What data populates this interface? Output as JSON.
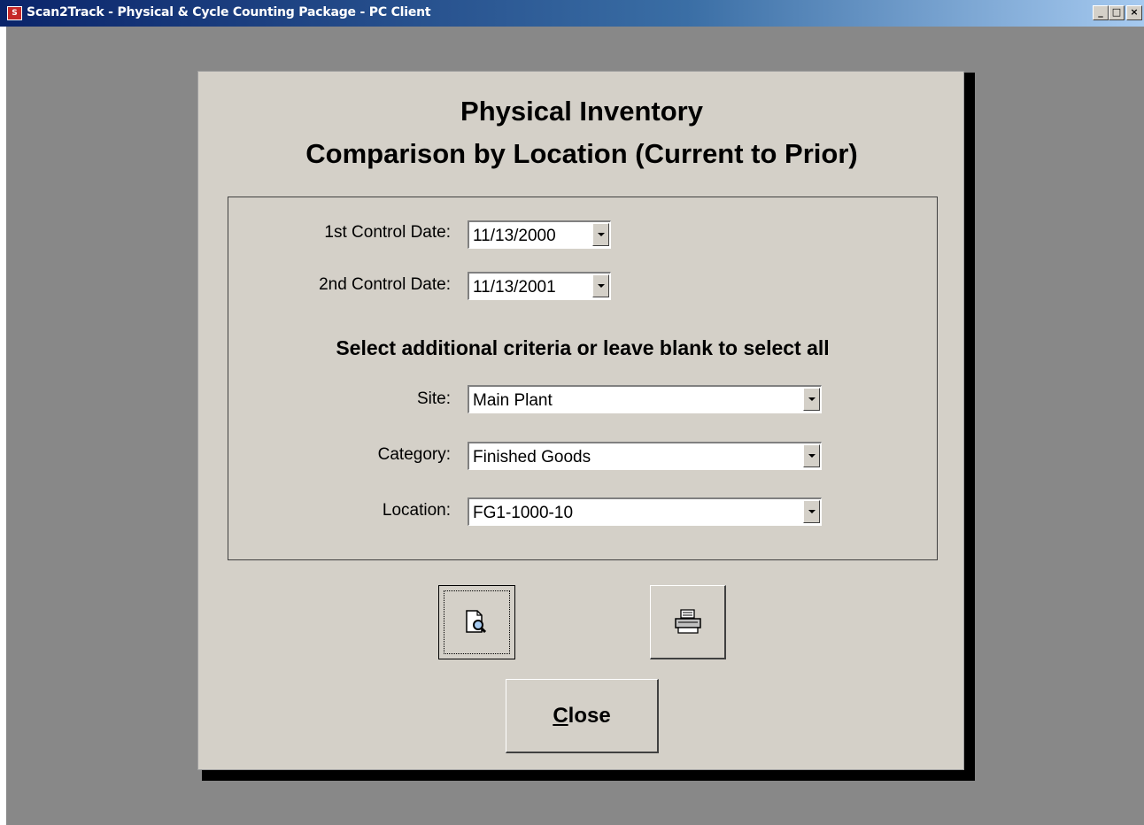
{
  "window": {
    "title": "Scan2Track - Physical & Cycle Counting Package - PC Client",
    "icon": "scan2track-app-icon",
    "controls": {
      "minimize": "_",
      "maximize": "□",
      "close": "×"
    }
  },
  "form": {
    "heading_line1": "Physical Inventory",
    "heading_line2": "Comparison by Location (Current to Prior)",
    "fields": {
      "control_date_1": {
        "label": "1st Control Date:",
        "value": "11/13/2000"
      },
      "control_date_2": {
        "label": "2nd Control Date:",
        "value": "11/13/2001"
      }
    },
    "criteria_heading": "Select additional criteria or leave blank to select all",
    "criteria": {
      "site": {
        "label": "Site:",
        "value": "Main Plant"
      },
      "category": {
        "label": "Category:",
        "value": "Finished Goods"
      },
      "location": {
        "label": "Location:",
        "value": "FG1-1000-10"
      }
    },
    "buttons": {
      "preview_icon": "print-preview-icon",
      "print_icon": "printer-icon",
      "close_mnemonic": "C",
      "close_rest": "lose"
    }
  },
  "colors": {
    "titlebar_start": "#0a246a",
    "titlebar_end": "#a6caf0",
    "client_background": "#888888",
    "form_background": "#d4d0c8"
  }
}
